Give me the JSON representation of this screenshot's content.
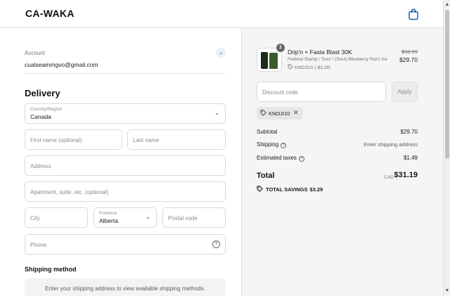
{
  "header": {
    "brand": "CA-WAKA",
    "cart_icon": "shopping-bag-icon"
  },
  "account": {
    "label": "Account",
    "email": "cualseammgvo@gmail.com",
    "expand_icon": "chevron-down-icon"
  },
  "delivery": {
    "heading": "Delivery",
    "country": {
      "label": "Country/Region",
      "value": "Canada"
    },
    "first_name": {
      "placeholder": "First name (optional)"
    },
    "last_name": {
      "placeholder": "Last name"
    },
    "address": {
      "placeholder": "Address"
    },
    "apartment": {
      "placeholder": "Apartment, suite, etc. (optional)"
    },
    "city": {
      "placeholder": "City"
    },
    "province": {
      "label": "Province",
      "value": "Alberta"
    },
    "postal": {
      "placeholder": "Postal code"
    },
    "phone": {
      "placeholder": "Phone",
      "help_icon": "question-circle-icon"
    }
  },
  "shipping_method": {
    "heading": "Shipping method",
    "message": "Enter your shipping address to view available shipping methods."
  },
  "order": {
    "item": {
      "quantity": "1",
      "name": "Drip'n × Fasta Blast 30K",
      "variant": "Federal Stamp / Sour / (Sour) Blueberry Razz Ice",
      "discount": "KNOJI10 (-$3.29)",
      "original_price": "$32.99",
      "price": "$29.70"
    },
    "discount_field": {
      "placeholder": "Discount code"
    },
    "apply_label": "Apply",
    "applied_code": "KNOJI10",
    "summary": {
      "subtotal_label": "Subtotal",
      "subtotal_value": "$29.70",
      "shipping_label": "Shipping",
      "shipping_value": "Enter shipping address",
      "taxes_label": "Estimated taxes",
      "taxes_value": "$1.49"
    },
    "total": {
      "label": "Total",
      "currency": "CAD",
      "value": "$31.19"
    },
    "savings": {
      "label": "TOTAL SAVINGS",
      "value": "$3.29"
    }
  }
}
